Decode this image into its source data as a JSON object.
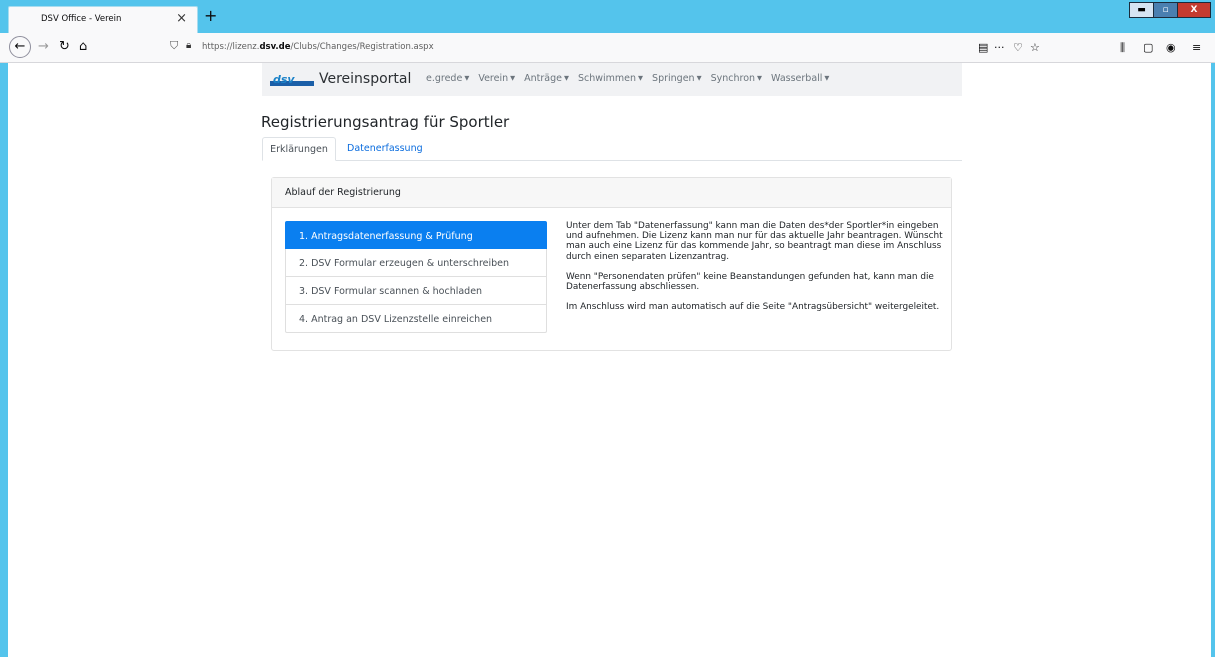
{
  "browser": {
    "tab_title": "DSV Office - Verein",
    "tab_close": "×",
    "new_tab": "+",
    "url_prefix": "https://lizenz.",
    "url_domain": "dsv.de",
    "url_path": "/Clubs/Changes/Registration.aspx",
    "window_controls": {
      "minimize": "▬",
      "maximize": "▫",
      "close": "X"
    }
  },
  "site": {
    "brand": "Vereinsportal",
    "menu": [
      "e.grede",
      "Verein",
      "Anträge",
      "Schwimmen",
      "Springen",
      "Synchron",
      "Wasserball"
    ]
  },
  "page": {
    "title": "Registrierungsantrag für Sportler",
    "tabs": [
      {
        "label": "Erklärungen"
      },
      {
        "label": "Datenerfassung"
      }
    ]
  },
  "card": {
    "header": "Ablauf der Registrierung",
    "steps": [
      {
        "label": "1. Antragsdatenerfassung & Prüfung",
        "active": true
      },
      {
        "label": "2. DSV Formular erzeugen & unterschreiben"
      },
      {
        "label": "3. DSV Formular scannen & hochladen"
      },
      {
        "label": "4. Antrag an DSV Lizenzstelle einreichen"
      }
    ],
    "paragraphs": [
      "Unter dem Tab \"Datenerfassung\" kann man die Daten des*der Sportler*in eingeben und aufnehmen. Die Lizenz kann man nur für das aktuelle Jahr beantragen. Wünscht man auch eine Lizenz für das kommende Jahr, so beantragt man diese im Anschluss durch einen separaten Lizenzantrag.",
      "Wenn \"Personendaten prüfen\" keine Beanstandungen gefunden hat, kann man die Datenerfassung abschliessen.",
      "Im Anschluss wird man automatisch auf die Seite \"Antragsübersicht\" weitergeleitet."
    ]
  },
  "colors": {
    "accent": "#0a7ff0",
    "link": "#0a6cde",
    "chrome": "#54c4ec"
  }
}
